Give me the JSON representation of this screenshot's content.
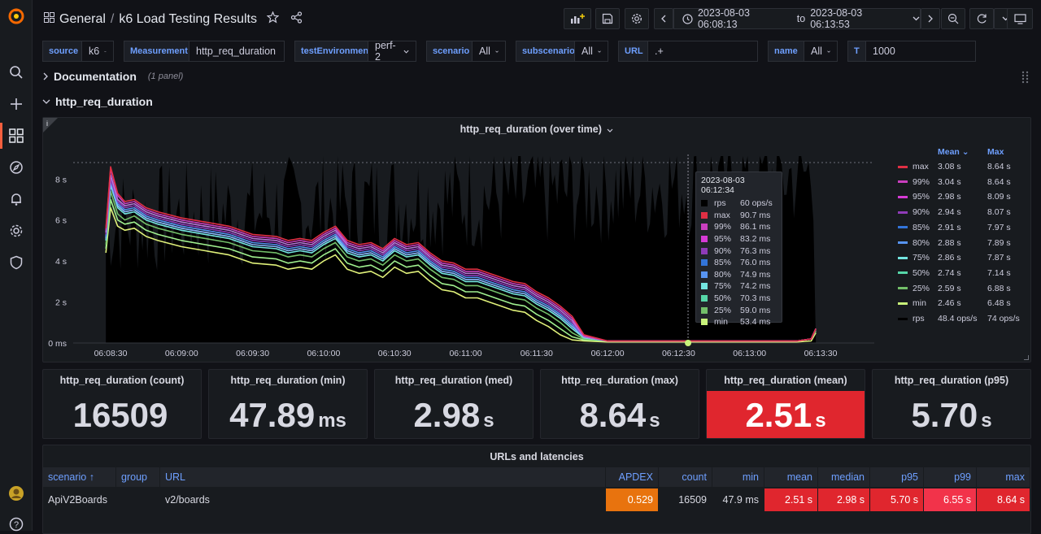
{
  "app": {
    "breadcrumb_folder": "General",
    "breadcrumb_sep": "/",
    "dashboard_title": "k6 Load Testing Results",
    "time_range_from": "2023-08-03 06:08:13",
    "time_range_to_word": "to",
    "time_range_to": "2023-08-03 06:13:53"
  },
  "variables": [
    {
      "label": "source",
      "value": "k6"
    },
    {
      "label": "Measurement",
      "value": "http_req_duration"
    },
    {
      "label": "testEnvironment",
      "value": "perf-2"
    },
    {
      "label": "scenario",
      "value": "All"
    },
    {
      "label": "subscenario",
      "value": "All"
    },
    {
      "label": "URL",
      "value": ".+"
    },
    {
      "label": "name",
      "value": "All"
    },
    {
      "label": "T",
      "value": "1000"
    }
  ],
  "rows": {
    "documentation": {
      "title": "Documentation",
      "sub": "(1 panel)"
    },
    "http_req_duration": {
      "title": "http_req_duration"
    }
  },
  "graph_panel": {
    "title": "http_req_duration (over time)",
    "info_icon": "i"
  },
  "chart_data": {
    "type": "line",
    "title": "http_req_duration (over time)",
    "x_ticks": [
      "06:08:30",
      "06:09:00",
      "06:09:30",
      "06:10:00",
      "06:10:30",
      "06:11:00",
      "06:11:30",
      "06:12:00",
      "06:12:30",
      "06:13:00",
      "06:13:30"
    ],
    "y_ticks": [
      "0 ms",
      "2 s",
      "4 s",
      "6 s",
      "8 s"
    ],
    "ylim": [
      0,
      9.4
    ],
    "x": [
      "06:08:28",
      "06:08:30",
      "06:08:33",
      "06:08:36",
      "06:08:40",
      "06:08:45",
      "06:08:50",
      "06:09:00",
      "06:09:10",
      "06:09:20",
      "06:09:30",
      "06:09:40",
      "06:09:45",
      "06:09:50",
      "06:09:55",
      "06:10:00",
      "06:10:05",
      "06:10:10",
      "06:10:15",
      "06:10:20",
      "06:10:25",
      "06:10:30",
      "06:10:35",
      "06:10:40",
      "06:10:45",
      "06:10:50",
      "06:10:55",
      "06:11:00",
      "06:11:05",
      "06:11:10",
      "06:11:15",
      "06:11:20",
      "06:11:25",
      "06:11:30",
      "06:11:35",
      "06:11:40",
      "06:11:45",
      "06:11:50",
      "06:12:00",
      "06:12:30",
      "06:13:00",
      "06:13:20",
      "06:13:26",
      "06:13:28"
    ],
    "series": [
      {
        "name": "max",
        "color": "#e02f44",
        "values": [
          5.6,
          8.6,
          7.3,
          6.9,
          7.0,
          6.6,
          6.4,
          6.1,
          5.9,
          5.7,
          5.3,
          5.2,
          5.0,
          5.1,
          5.0,
          5.4,
          5.7,
          5.0,
          4.8,
          4.9,
          4.6,
          5.1,
          4.8,
          4.9,
          4.4,
          4.0,
          3.9,
          3.6,
          3.6,
          3.4,
          3.2,
          3.0,
          2.9,
          2.5,
          2.2,
          1.8,
          1.3,
          0.4,
          0.1,
          0.1,
          0.1,
          0.1,
          0.2,
          0.7
        ]
      },
      {
        "name": "99%",
        "color": "#ca3fbf",
        "values": [
          5.5,
          8.5,
          7.2,
          6.8,
          6.9,
          6.5,
          6.3,
          6.0,
          5.8,
          5.6,
          5.2,
          5.1,
          4.9,
          5.0,
          4.9,
          5.3,
          5.6,
          4.9,
          4.7,
          4.8,
          4.5,
          5.0,
          4.7,
          4.8,
          4.3,
          3.9,
          3.8,
          3.5,
          3.5,
          3.3,
          3.1,
          2.9,
          2.8,
          2.4,
          2.1,
          1.7,
          1.2,
          0.35,
          0.1,
          0.1,
          0.1,
          0.1,
          0.2,
          0.7
        ]
      },
      {
        "name": "95%",
        "color": "#b877d9",
        "values": [
          5.4,
          8.2,
          7.0,
          6.7,
          6.8,
          6.4,
          6.2,
          5.9,
          5.7,
          5.5,
          5.1,
          5.0,
          4.8,
          4.9,
          4.8,
          5.2,
          5.5,
          4.8,
          4.6,
          4.7,
          4.4,
          4.9,
          4.6,
          4.7,
          4.2,
          3.8,
          3.7,
          3.4,
          3.4,
          3.2,
          3.0,
          2.8,
          2.7,
          2.3,
          2.0,
          1.6,
          1.1,
          0.3,
          0.1,
          0.1,
          0.1,
          0.1,
          0.2,
          0.7
        ]
      },
      {
        "name": "90%",
        "color": "#8f3bb8",
        "values": [
          5.3,
          8.0,
          6.9,
          6.6,
          6.7,
          6.3,
          6.1,
          5.8,
          5.6,
          5.4,
          5.0,
          4.9,
          4.7,
          4.8,
          4.7,
          5.1,
          5.4,
          4.7,
          4.5,
          4.6,
          4.3,
          4.8,
          4.5,
          4.6,
          4.1,
          3.7,
          3.6,
          3.3,
          3.3,
          3.1,
          2.9,
          2.7,
          2.6,
          2.2,
          1.9,
          1.5,
          1.0,
          0.3,
          0.1,
          0.1,
          0.1,
          0.1,
          0.2,
          0.7
        ]
      },
      {
        "name": "85%",
        "color": "#5794f2",
        "values": [
          5.2,
          7.9,
          6.8,
          6.5,
          6.6,
          6.2,
          6.0,
          5.7,
          5.5,
          5.3,
          4.9,
          4.8,
          4.6,
          4.7,
          4.6,
          5.0,
          5.3,
          4.6,
          4.4,
          4.5,
          4.2,
          4.7,
          4.4,
          4.5,
          4.0,
          3.6,
          3.5,
          3.2,
          3.2,
          3.0,
          2.8,
          2.6,
          2.5,
          2.1,
          1.8,
          1.4,
          0.9,
          0.3,
          0.1,
          0.1,
          0.1,
          0.1,
          0.2,
          0.7
        ]
      },
      {
        "name": "80%",
        "color": "#8ab8ff",
        "values": [
          5.1,
          7.8,
          6.7,
          6.4,
          6.5,
          6.1,
          5.9,
          5.6,
          5.4,
          5.2,
          4.8,
          4.7,
          4.5,
          4.6,
          4.5,
          4.9,
          5.2,
          4.5,
          4.3,
          4.4,
          4.1,
          4.6,
          4.3,
          4.4,
          3.9,
          3.5,
          3.4,
          3.1,
          3.1,
          2.9,
          2.7,
          2.5,
          2.4,
          2.0,
          1.7,
          1.3,
          0.8,
          0.3,
          0.1,
          0.1,
          0.1,
          0.1,
          0.2,
          0.7
        ]
      },
      {
        "name": "75%",
        "color": "#73e5e0",
        "values": [
          5.0,
          7.7,
          6.6,
          6.3,
          6.4,
          6.0,
          5.8,
          5.5,
          5.3,
          5.1,
          4.7,
          4.6,
          4.4,
          4.5,
          4.4,
          4.8,
          5.1,
          4.4,
          4.2,
          4.3,
          4.0,
          4.5,
          4.2,
          4.3,
          3.8,
          3.4,
          3.3,
          3.0,
          3.0,
          2.8,
          2.6,
          2.4,
          2.3,
          1.9,
          1.6,
          1.2,
          0.7,
          0.25,
          0.1,
          0.1,
          0.1,
          0.1,
          0.2,
          0.7
        ]
      },
      {
        "name": "50%",
        "color": "#73bf69",
        "values": [
          4.8,
          7.4,
          6.3,
          6.0,
          6.2,
          5.8,
          5.6,
          5.3,
          5.1,
          4.9,
          4.5,
          4.4,
          4.2,
          4.3,
          4.2,
          4.6,
          4.9,
          4.2,
          4.0,
          4.1,
          3.8,
          4.3,
          4.0,
          4.1,
          3.6,
          3.2,
          3.1,
          2.8,
          2.8,
          2.6,
          2.4,
          2.2,
          2.1,
          1.7,
          1.4,
          1.0,
          0.5,
          0.2,
          0.1,
          0.1,
          0.1,
          0.1,
          0.2,
          0.6
        ]
      },
      {
        "name": "25%",
        "color": "#a0f08f",
        "values": [
          4.6,
          7.0,
          6.0,
          5.8,
          5.9,
          5.5,
          5.3,
          5.0,
          4.8,
          4.6,
          4.2,
          4.1,
          3.9,
          4.0,
          3.9,
          4.3,
          4.6,
          3.9,
          3.7,
          3.8,
          3.5,
          4.0,
          3.7,
          3.8,
          3.3,
          2.9,
          2.8,
          2.5,
          2.5,
          2.3,
          2.1,
          1.9,
          1.8,
          1.4,
          1.1,
          0.7,
          0.3,
          0.15,
          0.1,
          0.1,
          0.1,
          0.1,
          0.2,
          0.6
        ]
      },
      {
        "name": "min",
        "color": "#e0f17a",
        "values": [
          4.4,
          6.6,
          5.7,
          5.5,
          5.6,
          5.2,
          5.0,
          4.7,
          4.5,
          4.3,
          3.9,
          3.8,
          3.6,
          3.7,
          3.6,
          4.0,
          4.3,
          3.6,
          3.4,
          3.5,
          3.2,
          3.7,
          3.4,
          3.5,
          3.0,
          2.6,
          2.5,
          2.2,
          2.2,
          2.0,
          1.8,
          1.6,
          1.5,
          1.1,
          0.8,
          0.4,
          0.15,
          0.1,
          0.05,
          0.05,
          0.05,
          0.05,
          0.1,
          0.5
        ]
      }
    ],
    "rps_series": {
      "name": "rps",
      "color": "#000000",
      "axis": "right",
      "note": "rendered as black filled area"
    },
    "legend": {
      "headers": {
        "mean": "Mean",
        "max": "Max"
      },
      "rows": [
        {
          "name": "max",
          "color": "#e02f44",
          "mean": "3.08 s",
          "max": "8.64 s"
        },
        {
          "name": "99%",
          "color": "#ca3fbf",
          "mean": "3.04 s",
          "max": "8.64 s"
        },
        {
          "name": "95%",
          "color": "#d63ad6",
          "mean": "2.98 s",
          "max": "8.09 s"
        },
        {
          "name": "90%",
          "color": "#8f3bb8",
          "mean": "2.94 s",
          "max": "8.07 s"
        },
        {
          "name": "85%",
          "color": "#3274d9",
          "mean": "2.91 s",
          "max": "7.97 s"
        },
        {
          "name": "80%",
          "color": "#5794f2",
          "mean": "2.88 s",
          "max": "7.89 s"
        },
        {
          "name": "75%",
          "color": "#73e5e0",
          "mean": "2.86 s",
          "max": "7.87 s"
        },
        {
          "name": "50%",
          "color": "#56d6a8",
          "mean": "2.74 s",
          "max": "7.14 s"
        },
        {
          "name": "25%",
          "color": "#73bf69",
          "mean": "2.59 s",
          "max": "6.88 s"
        },
        {
          "name": "min",
          "color": "#c8f27a",
          "mean": "2.46 s",
          "max": "6.48 s"
        },
        {
          "name": "rps",
          "color": "#000000",
          "mean": "48.4 ops/s",
          "max": "74 ops/s"
        }
      ]
    },
    "tooltip": {
      "time": "2023-08-03 06:12:34",
      "rows": [
        {
          "name": "rps",
          "value": "60 ops/s",
          "color": "#000000"
        },
        {
          "name": "max",
          "value": "90.7 ms",
          "color": "#e02f44"
        },
        {
          "name": "99%",
          "value": "86.1 ms",
          "color": "#ca3fbf"
        },
        {
          "name": "95%",
          "value": "83.2 ms",
          "color": "#d63ad6"
        },
        {
          "name": "90%",
          "value": "76.3 ms",
          "color": "#8f3bb8"
        },
        {
          "name": "85%",
          "value": "76.0 ms",
          "color": "#3274d9"
        },
        {
          "name": "80%",
          "value": "74.9 ms",
          "color": "#5794f2"
        },
        {
          "name": "75%",
          "value": "74.2 ms",
          "color": "#73e5e0"
        },
        {
          "name": "50%",
          "value": "70.3 ms",
          "color": "#56d6a8"
        },
        {
          "name": "25%",
          "value": "59.0 ms",
          "color": "#73bf69"
        },
        {
          "name": "min",
          "value": "53.4 ms",
          "color": "#c8f27a"
        }
      ]
    }
  },
  "stats": [
    {
      "title": "http_req_duration (count)",
      "value": "16509",
      "unit": "",
      "highlight": false
    },
    {
      "title": "http_req_duration (min)",
      "value": "47.89",
      "unit": "ms",
      "highlight": false
    },
    {
      "title": "http_req_duration (med)",
      "value": "2.98",
      "unit": "s",
      "highlight": false
    },
    {
      "title": "http_req_duration (max)",
      "value": "8.64",
      "unit": "s",
      "highlight": false
    },
    {
      "title": "http_req_duration (mean)",
      "value": "2.51",
      "unit": "s",
      "highlight": true
    },
    {
      "title": "http_req_duration (p95)",
      "value": "5.70",
      "unit": "s",
      "highlight": false
    }
  ],
  "table": {
    "title": "URLs and latencies",
    "headers": [
      "scenario ↑",
      "group",
      "URL",
      "APDEX",
      "count",
      "min",
      "mean",
      "median",
      "p95",
      "p99",
      "max"
    ],
    "rows": [
      [
        "ApiV2Boards",
        "",
        "v2/boards",
        "0.529",
        "16509",
        "47.9 ms",
        "2.51 s",
        "2.98 s",
        "5.70 s",
        "6.55 s",
        "8.64 s"
      ]
    ]
  },
  "colors": {
    "accent": "#f55f3e",
    "link": "#6e9fff",
    "stat_red": "#e0262e",
    "apdex_orange": "#e8730e",
    "cell_red": "#e0262e"
  }
}
